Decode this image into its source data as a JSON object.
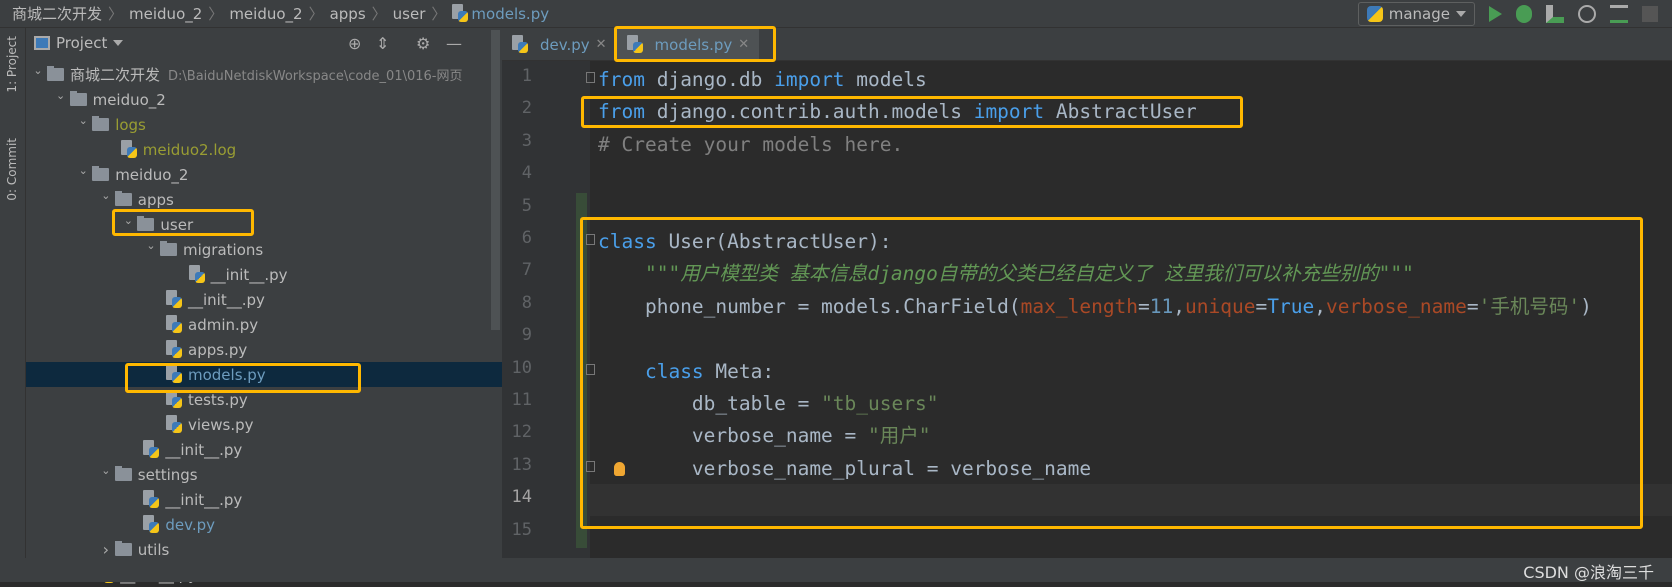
{
  "breadcrumb": [
    "商城二次开发",
    "meiduo_2",
    "meiduo_2",
    "apps",
    "user",
    "models.py"
  ],
  "run_config": {
    "label": "manage",
    "icon": "python-icon"
  },
  "toolbar_icons": [
    "run-icon",
    "debug-icon",
    "coverage-icon",
    "profile-icon",
    "concurrency-icon",
    "stop-icon"
  ],
  "left_strip": {
    "project": "1: Project",
    "commit": "0: Commit"
  },
  "project_panel": {
    "title": "Project",
    "tree": [
      {
        "label": "商城二次开发",
        "level": 0,
        "type": "folder",
        "open": true,
        "path": "D:\\BaiduNetdiskWorkspace\\code_01\\016-网页"
      },
      {
        "label": "meiduo_2",
        "level": 1,
        "type": "folder",
        "open": true
      },
      {
        "label": "logs",
        "level": 2,
        "type": "folder",
        "open": true,
        "color": "#999d33"
      },
      {
        "label": "meiduo2.log",
        "level": 3,
        "type": "file",
        "color": "#999d33"
      },
      {
        "label": "meiduo_2",
        "level": 2,
        "type": "folder",
        "open": true
      },
      {
        "label": "apps",
        "level": 3,
        "type": "folder",
        "open": true
      },
      {
        "label": "user",
        "level": 4,
        "type": "folder",
        "open": true
      },
      {
        "label": "migrations",
        "level": 5,
        "type": "folder",
        "open": true
      },
      {
        "label": "__init__.py",
        "level": 6,
        "type": "file"
      },
      {
        "label": "__init__.py",
        "level": 5,
        "type": "file"
      },
      {
        "label": "admin.py",
        "level": 5,
        "type": "file"
      },
      {
        "label": "apps.py",
        "level": 5,
        "type": "file"
      },
      {
        "label": "models.py",
        "level": 5,
        "type": "file",
        "selected": true,
        "color": "#6d9cbe"
      },
      {
        "label": "tests.py",
        "level": 5,
        "type": "file"
      },
      {
        "label": "views.py",
        "level": 5,
        "type": "file"
      },
      {
        "label": "__init__.py",
        "level": 4,
        "type": "file"
      },
      {
        "label": "settings",
        "level": 3,
        "type": "folder",
        "open": true
      },
      {
        "label": "__init__.py",
        "level": 4,
        "type": "file"
      },
      {
        "label": "dev.py",
        "level": 4,
        "type": "file",
        "color": "#6d9cbe"
      },
      {
        "label": "utils",
        "level": 3,
        "type": "folder",
        "open": false
      },
      {
        "label": "__init__.py",
        "level": 2,
        "type": "file"
      }
    ]
  },
  "tabs": [
    {
      "label": "dev.py",
      "active": false
    },
    {
      "label": "models.py",
      "active": true
    }
  ],
  "code": [
    [
      [
        "from",
        "kw"
      ],
      [
        " django.db ",
        ""
      ],
      [
        "import",
        "kw"
      ],
      [
        " models",
        ""
      ]
    ],
    [
      [
        "from",
        "kw"
      ],
      [
        " django.contrib.auth.models ",
        ""
      ],
      [
        "import",
        "kw"
      ],
      [
        " AbstractUser",
        ""
      ]
    ],
    [
      [
        "# Create your models here.",
        "cm"
      ]
    ],
    [],
    [],
    [
      [
        "class",
        "kw"
      ],
      [
        " User(AbstractUser):",
        ""
      ]
    ],
    [
      [
        "    ",
        ""
      ],
      [
        "\"\"\"用户模型类 基本信息django自带的父类已经自定义了 这里我们可以补充些别的\"\"\"",
        "doc"
      ]
    ],
    [
      [
        "    phone_number = models.CharField(",
        ""
      ],
      [
        "max_length",
        "par"
      ],
      [
        "=",
        ""
      ],
      [
        "11",
        "num"
      ],
      [
        ",",
        ""
      ],
      [
        "unique",
        "par"
      ],
      [
        "=",
        ""
      ],
      [
        "True",
        "kw"
      ],
      [
        ",",
        ""
      ],
      [
        "verbose_name",
        "par"
      ],
      [
        "=",
        ""
      ],
      [
        "'手机号码'",
        "str"
      ],
      [
        ")",
        ""
      ]
    ],
    [],
    [
      [
        "    ",
        ""
      ],
      [
        "class",
        "kw"
      ],
      [
        " Meta:",
        ""
      ]
    ],
    [
      [
        "        db_table = ",
        ""
      ],
      [
        "\"tb_users\"",
        "str"
      ]
    ],
    [
      [
        "        verbose_name = ",
        ""
      ],
      [
        "\"用户\"",
        "str"
      ]
    ],
    [
      [
        "        verbose_name_plural = verbose_name",
        ""
      ]
    ],
    [],
    []
  ],
  "current_line": 14,
  "highlight_color": "#ffb800",
  "watermark": "CSDN @浪淘三千"
}
